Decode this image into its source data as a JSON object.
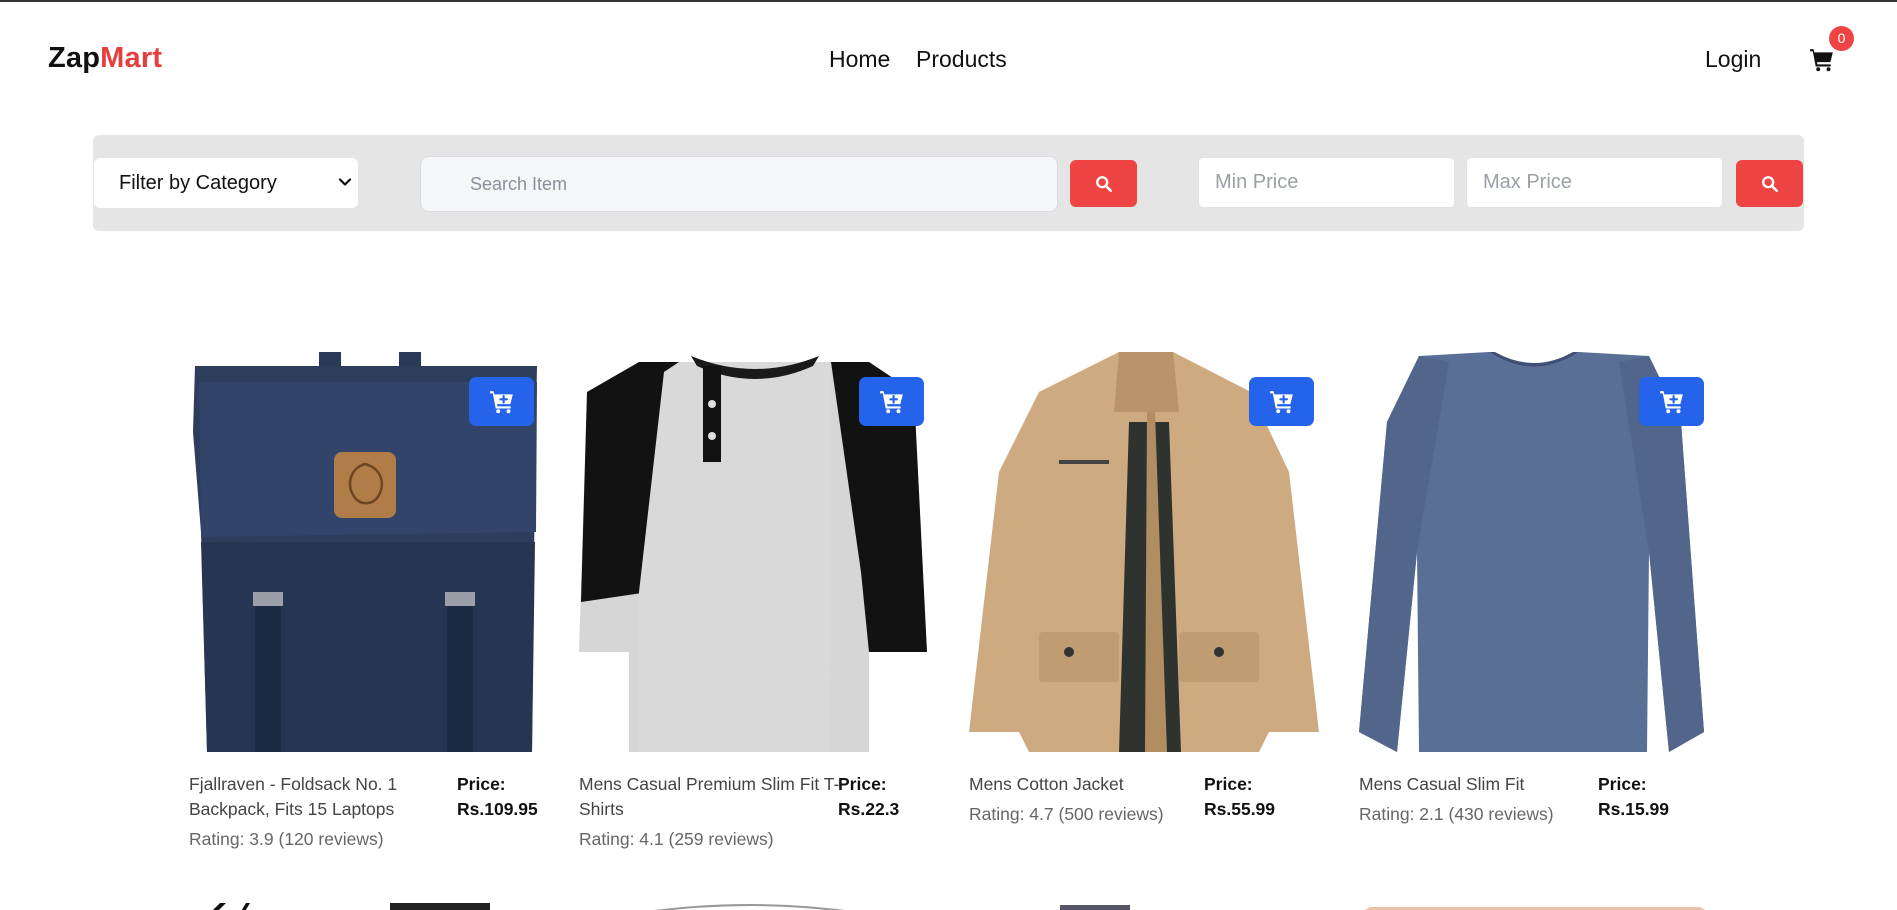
{
  "brand": {
    "part1": "Zap",
    "part2": "Mart"
  },
  "nav": {
    "home": "Home",
    "products": "Products"
  },
  "header": {
    "login": "Login",
    "cart_count": "0",
    "cart_icon": "cart-icon"
  },
  "filters": {
    "category_label": "Filter by Category",
    "search_placeholder": "Search Item",
    "min_price_placeholder": "Min Price",
    "max_price_placeholder": "Max Price"
  },
  "products": [
    {
      "title": "Fjallraven - Foldsack No. 1 Backpack, Fits 15 Laptops",
      "price_label": "Price:",
      "price": "Rs.109.95",
      "rating": "Rating: 3.9 (120 reviews)"
    },
    {
      "title": "Mens Casual Premium Slim Fit T-Shirts",
      "price_label": "Price:",
      "price": "Rs.22.3",
      "rating": "Rating: 4.1 (259 reviews)"
    },
    {
      "title": "Mens Cotton Jacket",
      "price_label": "Price:",
      "price": "Rs.55.99",
      "rating": "Rating: 4.7 (500 reviews)"
    },
    {
      "title": "Mens Casual Slim Fit",
      "price_label": "Price:",
      "price": "Rs.15.99",
      "rating": "Rating: 2.1 (430 reviews)"
    }
  ],
  "colors": {
    "accent_red": "#ef4444",
    "cart_button_blue": "#2563eb",
    "filter_bar_bg": "#e5e5e5"
  }
}
